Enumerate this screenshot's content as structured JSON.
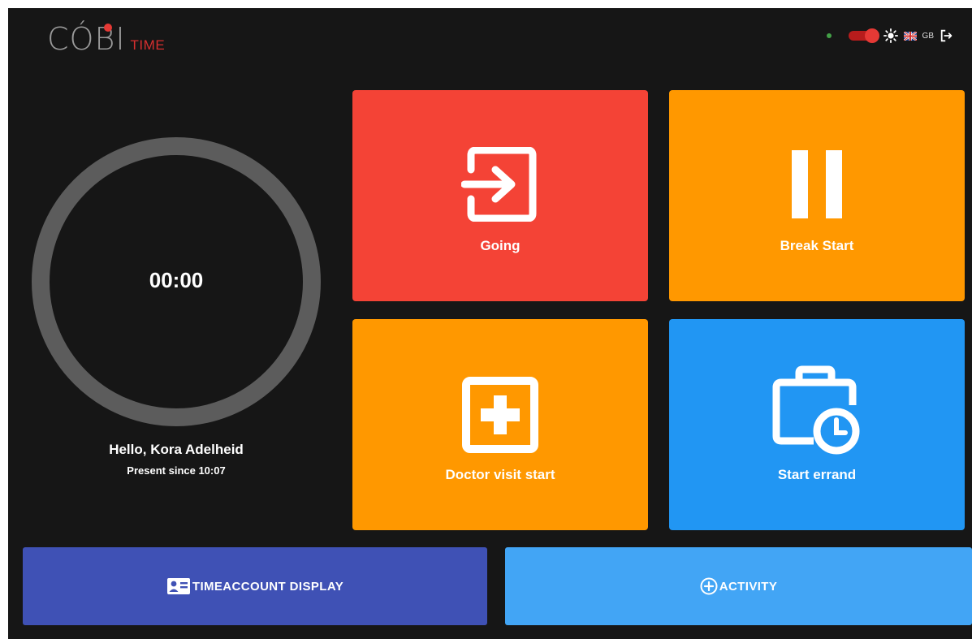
{
  "header": {
    "logo_main": "CÓBI",
    "logo_sub": "TIME",
    "status_color": "#43a047",
    "theme_icon": "sun-icon",
    "flag_icon": "uk-flag-icon",
    "language": "GB",
    "logout_icon": "logout-icon"
  },
  "timer": {
    "value": "00:00",
    "greeting": "Hello, Kora Adelheid",
    "present_since": "Present since 10:07"
  },
  "tiles": [
    {
      "label": "Going",
      "icon": "exit-icon",
      "color": "#f44336"
    },
    {
      "label": "Break Start",
      "icon": "pause-icon",
      "color": "#ff9800"
    },
    {
      "label": "Doctor visit start",
      "icon": "medical-cross-icon",
      "color": "#ff9800"
    },
    {
      "label": "Start errand",
      "icon": "briefcase-clock-icon",
      "color": "#2196f3"
    }
  ],
  "buttons": {
    "timeaccount": {
      "label": "TIMEACCOUNT DISPLAY",
      "icon": "id-card-icon",
      "color": "#3f51b5"
    },
    "activity": {
      "label": "ACTIVITY",
      "icon": "plus-circle-icon",
      "color": "#42a5f5"
    }
  }
}
